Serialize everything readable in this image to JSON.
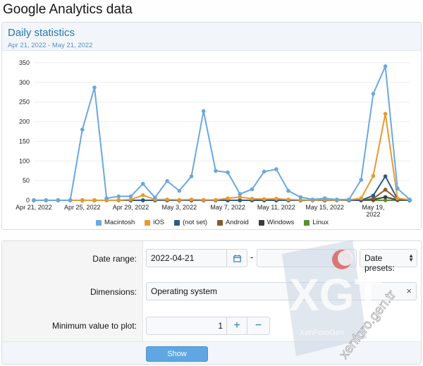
{
  "page": {
    "title": "Google Analytics data"
  },
  "stats": {
    "title": "Daily statistics",
    "subtitle": "Apr 21, 2022 - May 21, 2022"
  },
  "chart_data": {
    "type": "line",
    "x": [
      "Apr 21",
      "Apr 22",
      "Apr 23",
      "Apr 24",
      "Apr 25",
      "Apr 26",
      "Apr 27",
      "Apr 28",
      "Apr 29",
      "Apr 30",
      "May 1",
      "May 2",
      "May 3",
      "May 4",
      "May 5",
      "May 6",
      "May 7",
      "May 8",
      "May 9",
      "May 10",
      "May 11",
      "May 12",
      "May 13",
      "May 14",
      "May 15",
      "May 16",
      "May 17",
      "May 18",
      "May 19",
      "May 20",
      "May 21",
      "May 22"
    ],
    "x_tick_labels": [
      "Apr 21, 2022",
      "Apr 25, 2022",
      "Apr 29, 2022",
      "May 3, 2022",
      "May 7, 2022",
      "May 11, 2022",
      "May 15, 2022",
      "May 19, 2022"
    ],
    "ylim": [
      0,
      350
    ],
    "yticks": [
      0,
      50,
      100,
      150,
      200,
      250,
      300,
      350
    ],
    "grid": true,
    "legend_position": "bottom",
    "series": [
      {
        "name": "Macintosh",
        "color": "#6aa8e0",
        "values": [
          0,
          0,
          0,
          0,
          180,
          287,
          5,
          10,
          10,
          42,
          7,
          49,
          24,
          61,
          227,
          75,
          71,
          16,
          28,
          73,
          79,
          24,
          8,
          2,
          5,
          2,
          2,
          52,
          271,
          341,
          30,
          2
        ]
      },
      {
        "name": "iOS",
        "color": "#e8992f",
        "values": [
          0,
          0,
          0,
          0,
          0,
          0,
          0,
          0,
          2,
          13,
          2,
          2,
          1,
          2,
          1,
          1,
          5,
          8,
          4,
          3,
          4,
          2,
          1,
          0,
          1,
          0,
          1,
          5,
          62,
          220,
          5,
          1
        ]
      },
      {
        "name": "(not set)",
        "color": "#2e5a87",
        "values": [
          0,
          0,
          0,
          0,
          0,
          0,
          0,
          0,
          0,
          0,
          0,
          0,
          0,
          0,
          0,
          0,
          0,
          0,
          0,
          0,
          0,
          0,
          0,
          0,
          0,
          0,
          0,
          0,
          12,
          61,
          3,
          0
        ]
      },
      {
        "name": "Android",
        "color": "#8a5a2b",
        "values": [
          0,
          0,
          0,
          0,
          0,
          0,
          0,
          0,
          0,
          0,
          0,
          0,
          0,
          0,
          0,
          0,
          0,
          0,
          0,
          0,
          0,
          0,
          0,
          0,
          0,
          0,
          0,
          0,
          4,
          27,
          2,
          0
        ]
      },
      {
        "name": "Windows",
        "color": "#3b3b3b",
        "values": [
          0,
          0,
          0,
          0,
          0,
          0,
          0,
          0,
          0,
          0,
          0,
          0,
          0,
          0,
          0,
          0,
          0,
          0,
          0,
          0,
          0,
          0,
          0,
          0,
          0,
          0,
          0,
          0,
          2,
          8,
          1,
          0
        ]
      },
      {
        "name": "Linux",
        "color": "#5a8f2e",
        "values": [
          0,
          0,
          0,
          0,
          0,
          0,
          0,
          0,
          0,
          0,
          0,
          0,
          0,
          0,
          0,
          0,
          0,
          0,
          0,
          0,
          0,
          0,
          0,
          0,
          0,
          0,
          0,
          0,
          0,
          0,
          0,
          0
        ]
      }
    ]
  },
  "form": {
    "date_range_label": "Date range:",
    "start_date": "2022-04-21",
    "end_date": "",
    "date_separator": "-",
    "presets_label": "Date presets:",
    "dimensions_label": "Dimensions:",
    "dimensions_value": "Operating system",
    "min_value_label": "Minimum value to plot:",
    "min_value": "1",
    "show_button": "Show"
  },
  "icons": {
    "calendar": "calendar-icon",
    "plus": "plus-icon",
    "minus": "minus-icon",
    "remove": "close-icon"
  },
  "watermark": {
    "text": "xenforo.gen.tr",
    "logo_text": "XGT",
    "logo_caption": "XenForoGen"
  }
}
